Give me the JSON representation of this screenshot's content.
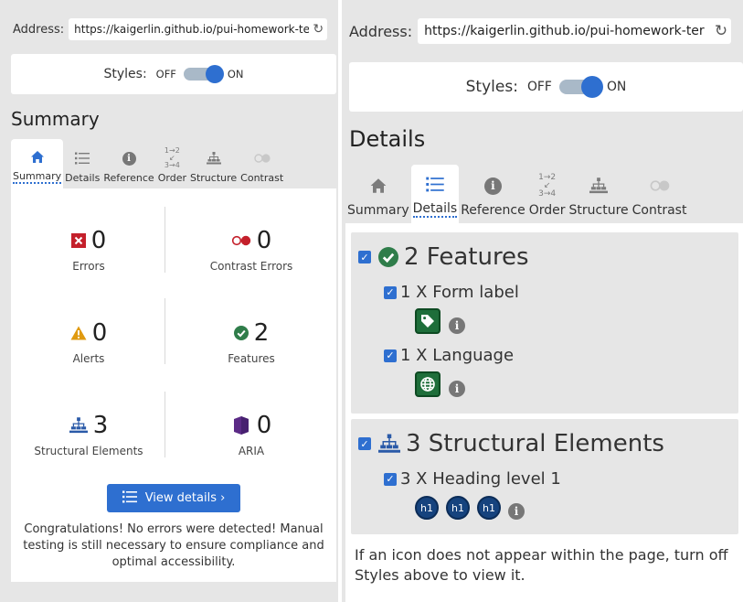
{
  "left": {
    "address_label": "Address:",
    "address_url": "https://kaigerlin.github.io/pui-homework-ter",
    "reload_icon": "reload-icon",
    "styles_label": "Styles:",
    "styles_off": "OFF",
    "styles_on": "ON",
    "styles_enabled": true,
    "panel_title": "Summary",
    "tabs": [
      {
        "label": "Summary",
        "icon": "home-icon",
        "active": true
      },
      {
        "label": "Details",
        "icon": "list-icon",
        "active": false
      },
      {
        "label": "Reference",
        "icon": "info-icon",
        "active": false
      },
      {
        "label": "Order",
        "icon": "order-icon",
        "active": false
      },
      {
        "label": "Structure",
        "icon": "structure-icon",
        "active": false
      },
      {
        "label": "Contrast",
        "icon": "contrast-icon",
        "active": false
      }
    ],
    "summary": [
      {
        "count": "0",
        "label": "Errors",
        "icon": "error-icon"
      },
      {
        "count": "0",
        "label": "Contrast Errors",
        "icon": "contrast-error-icon"
      },
      {
        "count": "0",
        "label": "Alerts",
        "icon": "alert-icon"
      },
      {
        "count": "2",
        "label": "Features",
        "icon": "feature-check-icon"
      },
      {
        "count": "3",
        "label": "Structural Elements",
        "icon": "structure-icon"
      },
      {
        "count": "0",
        "label": "ARIA",
        "icon": "aria-icon"
      }
    ],
    "view_details_label": "View details ›",
    "congrats_text": "Congratulations! No errors were detected! Manual testing is still necessary to ensure compliance and optimal accessibility."
  },
  "right": {
    "address_label": "Address:",
    "address_url": "https://kaigerlin.github.io/pui-homework-ter",
    "reload_icon": "reload-icon",
    "styles_label": "Styles:",
    "styles_off": "OFF",
    "styles_on": "ON",
    "styles_enabled": true,
    "panel_title": "Details",
    "tabs": [
      {
        "label": "Summary",
        "icon": "home-icon",
        "active": false
      },
      {
        "label": "Details",
        "icon": "list-icon",
        "active": true
      },
      {
        "label": "Reference",
        "icon": "info-icon",
        "active": false
      },
      {
        "label": "Order",
        "icon": "order-icon",
        "active": false
      },
      {
        "label": "Structure",
        "icon": "structure-icon",
        "active": false
      },
      {
        "label": "Contrast",
        "icon": "contrast-icon",
        "active": false
      }
    ],
    "groups": [
      {
        "heading": "2 Features",
        "checked": true,
        "icon": "feature-check-icon",
        "items": [
          {
            "label": "1 X Form label",
            "checked": true,
            "icons": [
              "form-label-tag-icon"
            ]
          },
          {
            "label": "1 X Language",
            "checked": true,
            "icons": [
              "language-globe-icon"
            ]
          }
        ]
      },
      {
        "heading": "3 Structural Elements",
        "checked": true,
        "icon": "structure-icon",
        "items": [
          {
            "label": "3 X Heading level 1",
            "checked": true,
            "icons": [
              "h1",
              "h1",
              "h1"
            ]
          }
        ]
      }
    ],
    "footnote": "If an icon does not appear within the page, turn off Styles above to view it."
  },
  "colors": {
    "accent": "#2e6fd0",
    "error": "#c4202b",
    "alert": "#e09a10",
    "feature": "#2f7d4a",
    "aria": "#5b2a86",
    "heading_badge": "#16437e"
  }
}
